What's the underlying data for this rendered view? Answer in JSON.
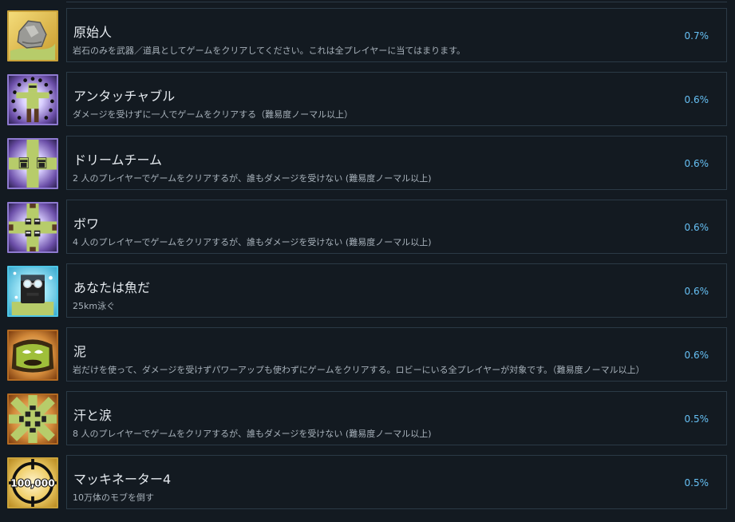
{
  "achievements": [
    {
      "title": "原始人",
      "description": "岩石のみを武器／道具としてゲームをクリアしてください。これは全プレイヤーに当てはまります。",
      "percent": "0.7%",
      "icon": "rock-in-hand-icon"
    },
    {
      "title": "アンタッチャブル",
      "description": "ダメージを受けずに一人でゲームをクリアする（難易度ノーマル以上）",
      "percent": "0.6%",
      "icon": "untouchable-figure-icon"
    },
    {
      "title": "ドリームチーム",
      "description": "2 人のプレイヤーでゲームをクリアするが、誰もダメージを受けない (難易度ノーマル以上)",
      "percent": "0.6%",
      "icon": "two-players-icon"
    },
    {
      "title": "ボワ",
      "description": "4 人のプレイヤーでゲームをクリアするが、誰もダメージを受けない (難易度ノーマル以上)",
      "percent": "0.6%",
      "icon": "four-players-icon"
    },
    {
      "title": "あなたは魚だ",
      "description": "25km泳ぐ",
      "percent": "0.6%",
      "icon": "swimmer-goggles-icon"
    },
    {
      "title": "泥",
      "description": "岩だけを使って、ダメージを受けずパワーアップも使わずにゲームをクリアする。ロビーにいる全プレイヤーが対象です。（難易度ノーマル以上）",
      "percent": "0.6%",
      "icon": "mud-face-icon"
    },
    {
      "title": "汗と涙",
      "description": "8 人のプレイヤーでゲームをクリアするが、誰もダメージを受けない (難易度ノーマル以上)",
      "percent": "0.5%",
      "icon": "eight-players-icon"
    },
    {
      "title": "マッキネーター4",
      "description": "10万体のモブを倒す",
      "percent": "0.5%",
      "icon": "crosshair-100000-icon",
      "icon_text": "100,000"
    }
  ],
  "colors": {
    "background": "#131a21",
    "card_border": "#2b3a46",
    "title": "#e4e9ee",
    "description": "#a8b2bb",
    "percent": "#66c0f4"
  }
}
